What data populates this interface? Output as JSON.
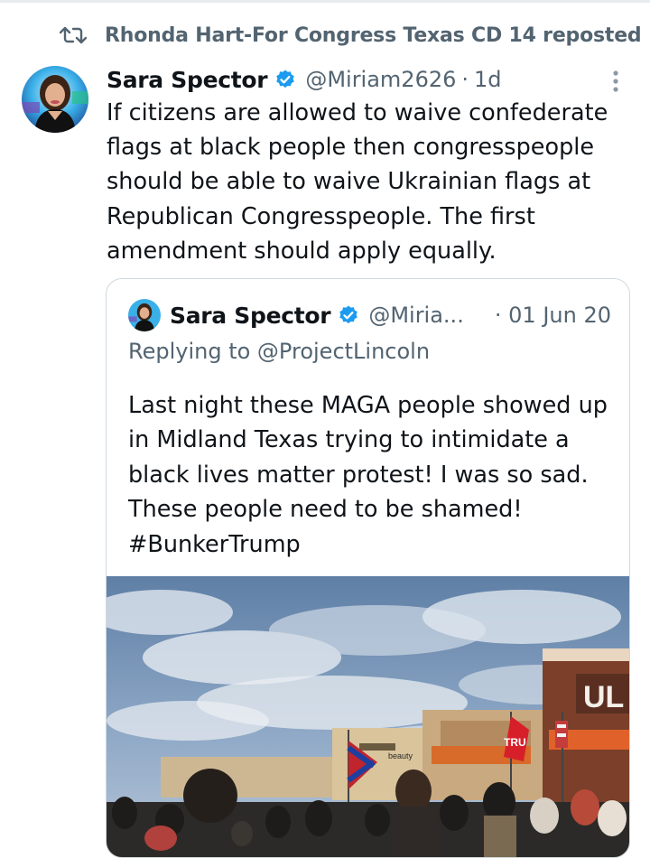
{
  "repost": {
    "text": "Rhonda Hart-For Congress Texas CD 14 reposted",
    "icon": "repost-icon"
  },
  "tweet": {
    "display_name": "Sara Spector",
    "handle": "@Miriam2626",
    "separator": "·",
    "time": "1d",
    "text": "If citizens are allowed to waive confederate flags at black people then congresspeople should be able to waive Ukrainian flags at Republican Congresspeople. The first amendment should apply equally.",
    "more_icon": "more-options-icon",
    "verified_icon": "verified-badge-icon"
  },
  "quote": {
    "display_name": "Sara Spector",
    "handle": "@Miria...",
    "time": "· 01 Jun 20",
    "replying_to": "Replying to @ProjectLincoln",
    "text_lines": [
      "Last night these MAGA people showed up",
      "in Midland Texas trying to intimidate a",
      "black lives matter protest! I was so sad.",
      "These people need to be shamed!",
      "#BunkerTrump"
    ],
    "photo": {
      "store_sign": "UL",
      "small_sign": "beauty",
      "flag_text": "TRU"
    }
  },
  "colors": {
    "text": "#0f1419",
    "secondary": "#536471",
    "verified": "#1d9bf0",
    "border": "#cfd9de"
  }
}
